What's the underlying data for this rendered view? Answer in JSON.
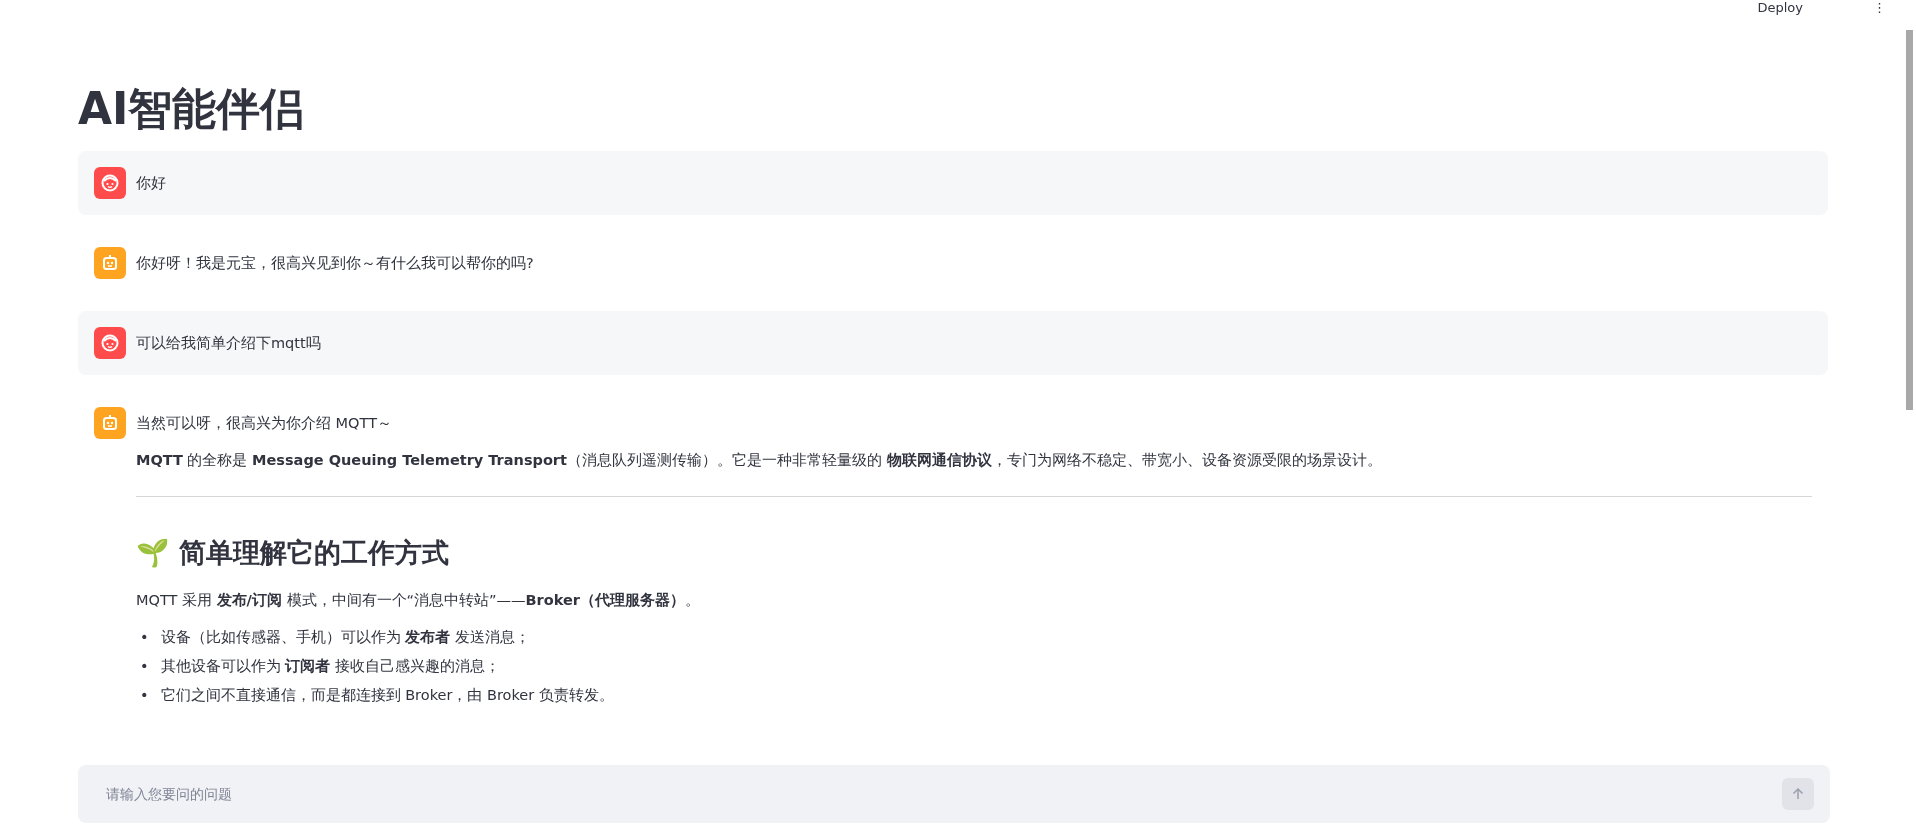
{
  "header": {
    "deploy": "Deploy",
    "menu": "⋮"
  },
  "title": "AI智能伴侣",
  "messages": [
    {
      "kind": "user",
      "paragraphs": [
        "你好"
      ]
    },
    {
      "kind": "assistant",
      "paragraphs": [
        "你好呀！我是元宝，很高兴见到你～有什么我可以帮你的吗?"
      ]
    },
    {
      "kind": "user",
      "paragraphs": [
        "可以给我简单介绍下mqtt吗"
      ]
    },
    {
      "kind": "assistant",
      "paragraphs": [
        "当然可以呀，很高兴为你介绍 MQTT～",
        "**MQTT** 的全称是 **Message Queuing Telemetry Transport**（消息队列遥测传输）。它是一种非常轻量级的 **物联网通信协议**，专门为网络不稳定、带宽小、设备资源受限的场景设计。"
      ],
      "heading": "🌱 简单理解它的工作方式",
      "after": "MQTT 采用 **发布/订阅** 模式，中间有一个“消息中转站”——**Broker（代理服务器）**。",
      "bullets": [
        {
          "marker": "•",
          "text": "设备（比如传感器、手机）可以作为 **发布者** 发送消息；"
        },
        {
          "marker": "•",
          "text": "其他设备可以作为 **订阅者** 接收自己感兴趣的消息；"
        },
        {
          "marker": "•",
          "text": "它们之间不直接通信，而是都连接到 Broker，由 Broker 负责转发。"
        }
      ]
    }
  ],
  "input": {
    "placeholder": "请输入您要问的问题"
  }
}
